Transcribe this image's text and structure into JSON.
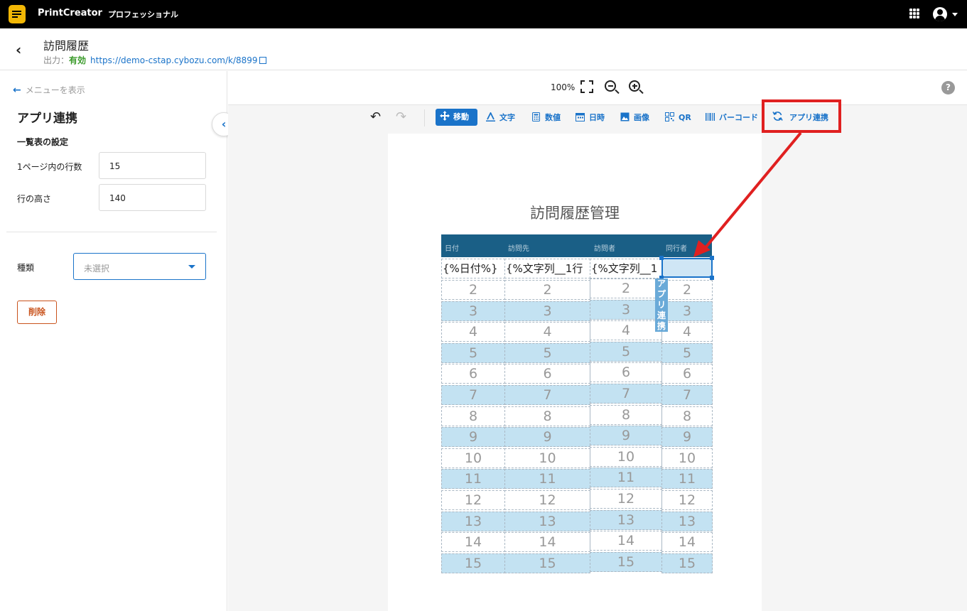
{
  "app": {
    "name": "PrintCreator",
    "edition": "プロフェッショナル"
  },
  "header": {
    "title": "訪問履歴",
    "output_label": "出力：",
    "output_status": "有効",
    "url": "https://demo-cstap.cybozu.com/k/8899"
  },
  "sidebar": {
    "menu_back": "メニューを表示",
    "title": "アプリ連携",
    "section_title": "一覧表の設定",
    "rows_label": "1ページ内の行数",
    "rows_value": "15",
    "height_label": "行の高さ",
    "height_value": "140",
    "type_label": "種類",
    "type_placeholder": "未選択",
    "delete_label": "削除"
  },
  "zoom": {
    "level": "100%"
  },
  "toolbar": {
    "move": "移動",
    "text": "文字",
    "number": "数値",
    "datetime": "日時",
    "image": "画像",
    "qr": "QR",
    "barcode": "バーコード",
    "app_link": "アプリ連携"
  },
  "document": {
    "title": "訪問履歴管理",
    "headers": [
      "日付",
      "訪問先",
      "訪問者",
      "同行者"
    ],
    "first_row": [
      "{%日付%}",
      "{%文字列__1行",
      "{%文字列__1",
      ""
    ],
    "row_numbers": [
      "2",
      "3",
      "4",
      "5",
      "6",
      "7",
      "8",
      "9",
      "10",
      "11",
      "12",
      "13",
      "14",
      "15"
    ],
    "selection_label": "アプリ連携"
  },
  "colors": {
    "accent": "#1a73c9",
    "table_header": "#1a5f86",
    "row_alt": "#c3e2f2",
    "highlight": "#e02020",
    "status_ok": "#3a9a2a",
    "delete": "#c9531c"
  }
}
